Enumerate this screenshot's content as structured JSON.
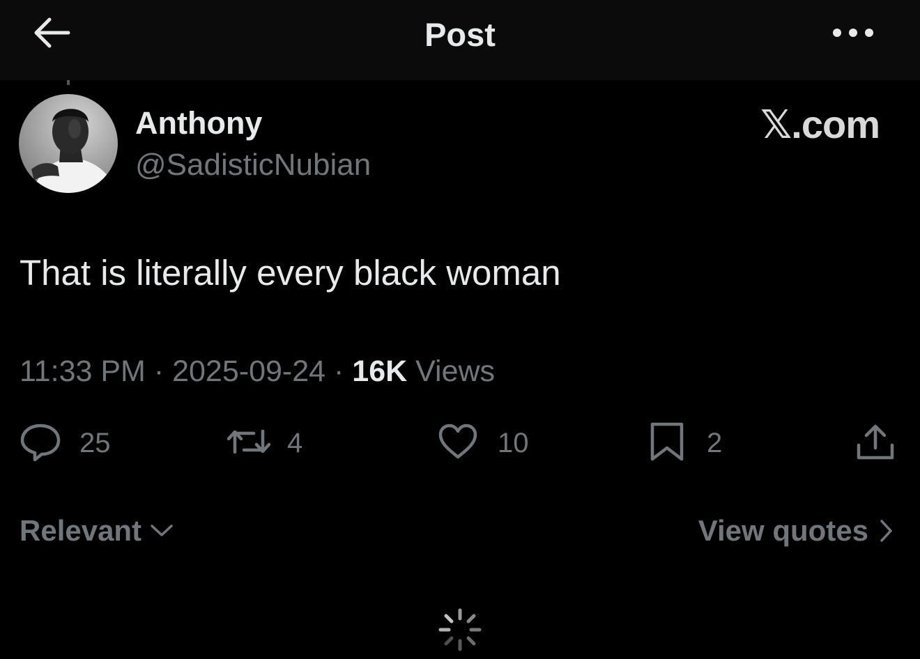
{
  "header": {
    "title": "Post",
    "back_icon": "arrow-left-icon",
    "more_icon": "more-horizontal-icon"
  },
  "post": {
    "author_name": "Anthony",
    "author_handle": "@SadisticNubian",
    "source": "𝕏.com",
    "text": "That is literally every black woman",
    "time": "11:33 PM",
    "separator": " · ",
    "date": "2025-09-24",
    "views_count": "16K",
    "views_label": " Views"
  },
  "actions": {
    "replies": "25",
    "reposts": "4",
    "likes": "10",
    "bookmarks": "2",
    "icons": [
      "reply-icon",
      "repost-icon",
      "like-icon",
      "bookmark-icon",
      "share-icon"
    ]
  },
  "footer": {
    "sort_label": "Relevant",
    "view_quotes_label": "View quotes"
  },
  "colors": {
    "background": "#000000",
    "header_background": "#0b0b0b",
    "primary_text": "#e7e9ea",
    "secondary_text": "#71767b"
  }
}
